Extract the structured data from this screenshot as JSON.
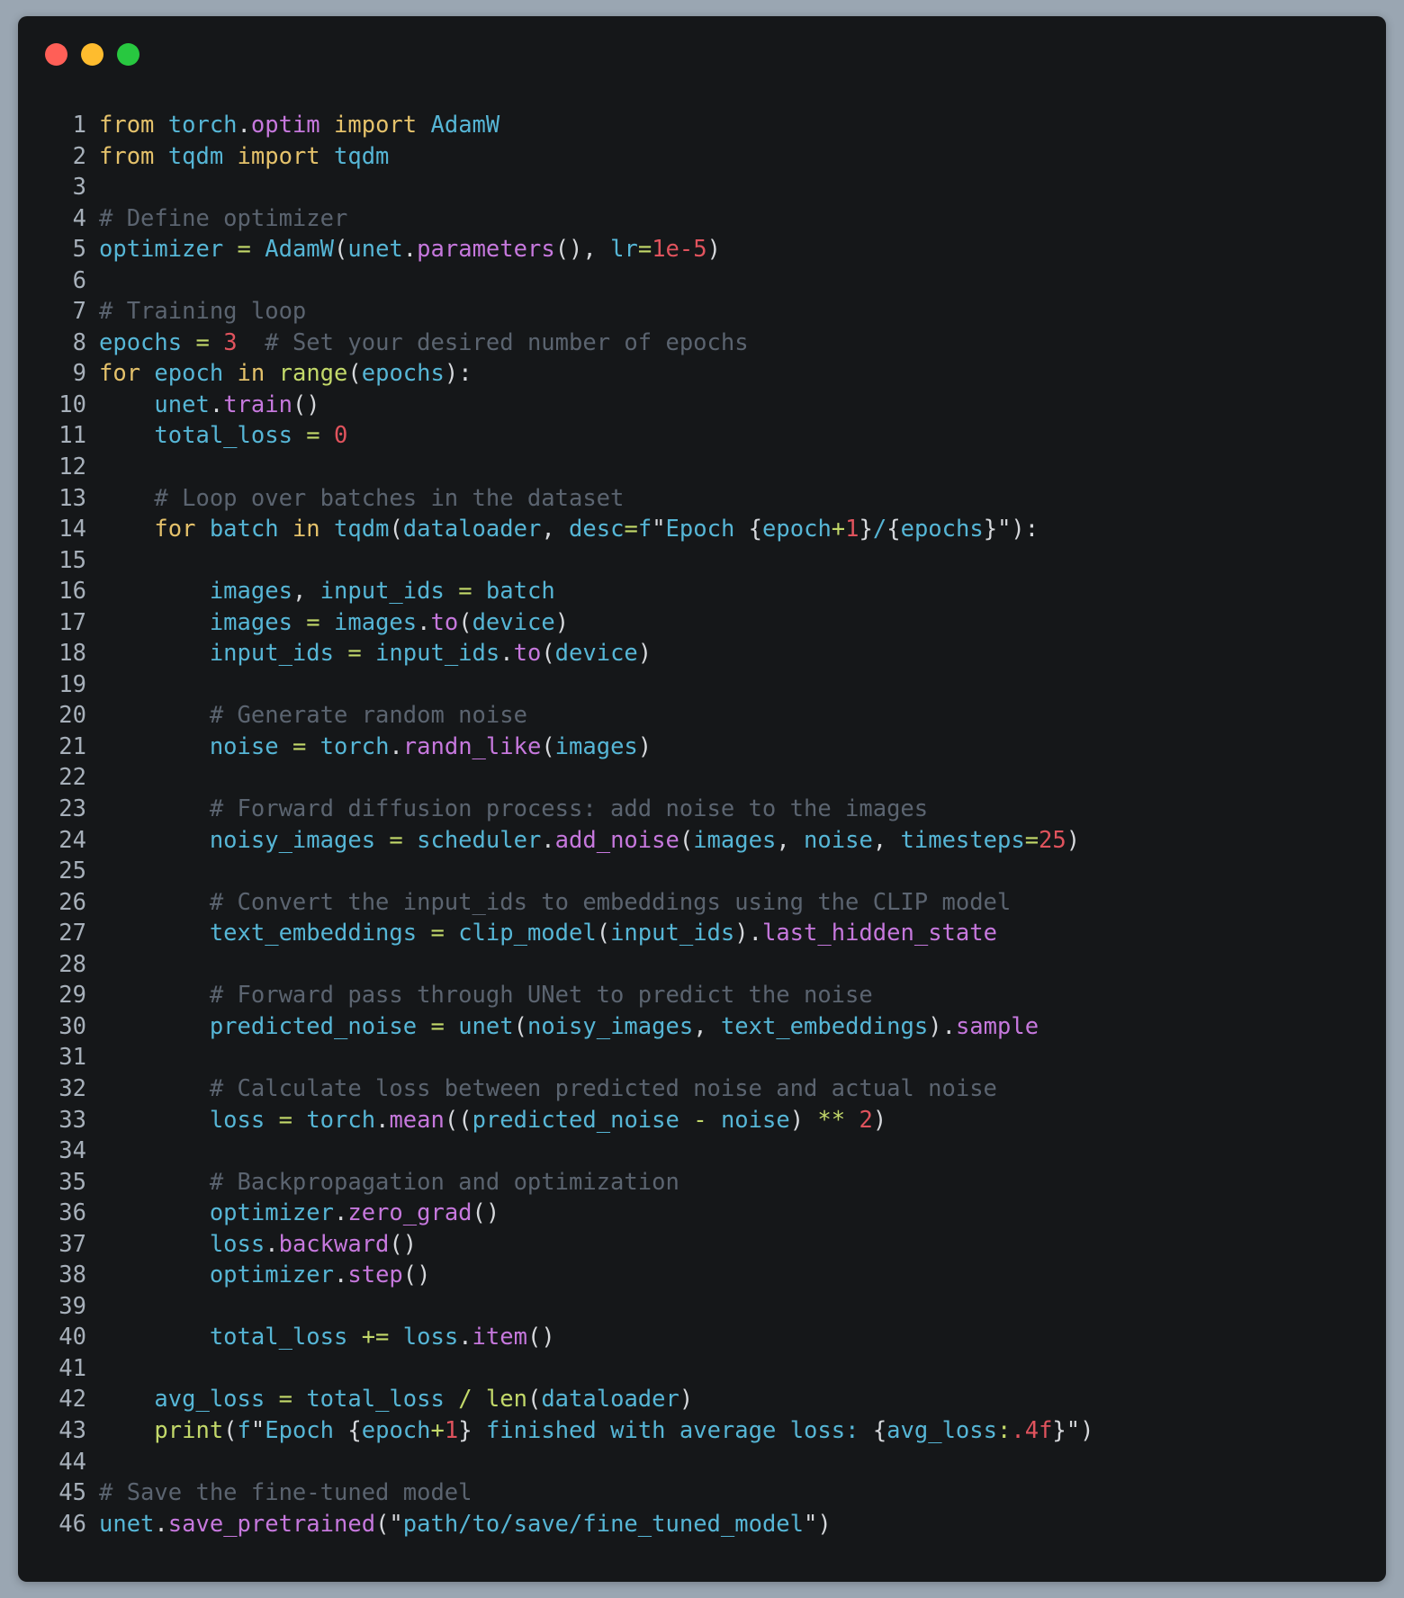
{
  "window": {
    "controls": [
      {
        "name": "close",
        "color": "#ff5f57"
      },
      {
        "name": "minimize",
        "color": "#febc2e"
      },
      {
        "name": "maximize",
        "color": "#28c840"
      }
    ]
  },
  "theme": {
    "kw": "#e5c26b",
    "var": "#56b6d6",
    "fn": "#c678dd",
    "num": "#e0535d",
    "op": "#c3d96a",
    "cm": "#5b6470",
    "p": "#d6d8dc",
    "lineno": "#a7b0ba"
  },
  "code_lines": [
    [
      [
        "kw",
        "from "
      ],
      [
        "var",
        "torch"
      ],
      [
        "p",
        "."
      ],
      [
        "fn",
        "optim "
      ],
      [
        "kw",
        "import "
      ],
      [
        "var",
        "AdamW"
      ]
    ],
    [
      [
        "kw",
        "from "
      ],
      [
        "var",
        "tqdm "
      ],
      [
        "kw",
        "import "
      ],
      [
        "var",
        "tqdm"
      ]
    ],
    [],
    [
      [
        "cm",
        "# Define optimizer"
      ]
    ],
    [
      [
        "var",
        "optimizer "
      ],
      [
        "op",
        "= "
      ],
      [
        "var",
        "AdamW"
      ],
      [
        "p",
        "("
      ],
      [
        "var",
        "unet"
      ],
      [
        "p",
        "."
      ],
      [
        "fn",
        "parameters"
      ],
      [
        "p",
        "(), "
      ],
      [
        "var",
        "lr"
      ],
      [
        "op",
        "="
      ],
      [
        "num",
        "1e-5"
      ],
      [
        "p",
        ")"
      ]
    ],
    [],
    [
      [
        "cm",
        "# Training loop"
      ]
    ],
    [
      [
        "var",
        "epochs "
      ],
      [
        "op",
        "= "
      ],
      [
        "num",
        "3"
      ],
      [
        "cm",
        "  # Set your desired number of epochs"
      ]
    ],
    [
      [
        "kw",
        "for "
      ],
      [
        "var",
        "epoch "
      ],
      [
        "kw",
        "in "
      ],
      [
        "op",
        "range"
      ],
      [
        "p",
        "("
      ],
      [
        "var",
        "epochs"
      ],
      [
        "p",
        "):"
      ]
    ],
    [
      [
        "var",
        "    unet"
      ],
      [
        "p",
        "."
      ],
      [
        "fn",
        "train"
      ],
      [
        "p",
        "()"
      ]
    ],
    [
      [
        "var",
        "    total_loss "
      ],
      [
        "op",
        "= "
      ],
      [
        "num",
        "0"
      ]
    ],
    [],
    [
      [
        "cm",
        "    # Loop over batches in the dataset"
      ]
    ],
    [
      [
        "kw",
        "    for "
      ],
      [
        "var",
        "batch "
      ],
      [
        "kw",
        "in "
      ],
      [
        "var",
        "tqdm"
      ],
      [
        "p",
        "("
      ],
      [
        "var",
        "dataloader"
      ],
      [
        "p",
        ", "
      ],
      [
        "var",
        "desc"
      ],
      [
        "op",
        "="
      ],
      [
        "var",
        "f"
      ],
      [
        "p",
        "\""
      ],
      [
        "var",
        "Epoch "
      ],
      [
        "p",
        "{"
      ],
      [
        "var",
        "epoch"
      ],
      [
        "op",
        "+"
      ],
      [
        "num",
        "1"
      ],
      [
        "p",
        "}"
      ],
      [
        "var",
        "/"
      ],
      [
        "p",
        "{"
      ],
      [
        "var",
        "epochs"
      ],
      [
        "p",
        "}\"):"
      ]
    ],
    [],
    [
      [
        "var",
        "        images"
      ],
      [
        "p",
        ", "
      ],
      [
        "var",
        "input_ids "
      ],
      [
        "op",
        "= "
      ],
      [
        "var",
        "batch"
      ]
    ],
    [
      [
        "var",
        "        images "
      ],
      [
        "op",
        "= "
      ],
      [
        "var",
        "images"
      ],
      [
        "p",
        "."
      ],
      [
        "fn",
        "to"
      ],
      [
        "p",
        "("
      ],
      [
        "var",
        "device"
      ],
      [
        "p",
        ")"
      ]
    ],
    [
      [
        "var",
        "        input_ids "
      ],
      [
        "op",
        "= "
      ],
      [
        "var",
        "input_ids"
      ],
      [
        "p",
        "."
      ],
      [
        "fn",
        "to"
      ],
      [
        "p",
        "("
      ],
      [
        "var",
        "device"
      ],
      [
        "p",
        ")"
      ]
    ],
    [],
    [
      [
        "cm",
        "        # Generate random noise"
      ]
    ],
    [
      [
        "var",
        "        noise "
      ],
      [
        "op",
        "= "
      ],
      [
        "var",
        "torch"
      ],
      [
        "p",
        "."
      ],
      [
        "fn",
        "randn_like"
      ],
      [
        "p",
        "("
      ],
      [
        "var",
        "images"
      ],
      [
        "p",
        ")"
      ]
    ],
    [],
    [
      [
        "cm",
        "        # Forward diffusion process: add noise to the images"
      ]
    ],
    [
      [
        "var",
        "        noisy_images "
      ],
      [
        "op",
        "= "
      ],
      [
        "var",
        "scheduler"
      ],
      [
        "p",
        "."
      ],
      [
        "fn",
        "add_noise"
      ],
      [
        "p",
        "("
      ],
      [
        "var",
        "images"
      ],
      [
        "p",
        ", "
      ],
      [
        "var",
        "noise"
      ],
      [
        "p",
        ", "
      ],
      [
        "var",
        "timesteps"
      ],
      [
        "op",
        "="
      ],
      [
        "num",
        "25"
      ],
      [
        "p",
        ")"
      ]
    ],
    [],
    [
      [
        "cm",
        "        # Convert the input_ids to embeddings using the CLIP model"
      ]
    ],
    [
      [
        "var",
        "        text_embeddings "
      ],
      [
        "op",
        "= "
      ],
      [
        "var",
        "clip_model"
      ],
      [
        "p",
        "("
      ],
      [
        "var",
        "input_ids"
      ],
      [
        "p",
        ")."
      ],
      [
        "fn",
        "last_hidden_state"
      ]
    ],
    [],
    [
      [
        "cm",
        "        # Forward pass through UNet to predict the noise"
      ]
    ],
    [
      [
        "var",
        "        predicted_noise "
      ],
      [
        "op",
        "= "
      ],
      [
        "var",
        "unet"
      ],
      [
        "p",
        "("
      ],
      [
        "var",
        "noisy_images"
      ],
      [
        "p",
        ", "
      ],
      [
        "var",
        "text_embeddings"
      ],
      [
        "p",
        ")."
      ],
      [
        "fn",
        "sample"
      ]
    ],
    [],
    [
      [
        "cm",
        "        # Calculate loss between predicted noise and actual noise"
      ]
    ],
    [
      [
        "var",
        "        loss "
      ],
      [
        "op",
        "= "
      ],
      [
        "var",
        "torch"
      ],
      [
        "p",
        "."
      ],
      [
        "fn",
        "mean"
      ],
      [
        "p",
        "(("
      ],
      [
        "var",
        "predicted_noise "
      ],
      [
        "op",
        "- "
      ],
      [
        "var",
        "noise"
      ],
      [
        "p",
        ") "
      ],
      [
        "op",
        "** "
      ],
      [
        "num",
        "2"
      ],
      [
        "p",
        ")"
      ]
    ],
    [],
    [
      [
        "cm",
        "        # Backpropagation and optimization"
      ]
    ],
    [
      [
        "var",
        "        optimizer"
      ],
      [
        "p",
        "."
      ],
      [
        "fn",
        "zero_grad"
      ],
      [
        "p",
        "()"
      ]
    ],
    [
      [
        "var",
        "        loss"
      ],
      [
        "p",
        "."
      ],
      [
        "fn",
        "backward"
      ],
      [
        "p",
        "()"
      ]
    ],
    [
      [
        "var",
        "        optimizer"
      ],
      [
        "p",
        "."
      ],
      [
        "fn",
        "step"
      ],
      [
        "p",
        "()"
      ]
    ],
    [],
    [
      [
        "var",
        "        total_loss "
      ],
      [
        "op",
        "+= "
      ],
      [
        "var",
        "loss"
      ],
      [
        "p",
        "."
      ],
      [
        "fn",
        "item"
      ],
      [
        "p",
        "()"
      ]
    ],
    [],
    [
      [
        "var",
        "    avg_loss "
      ],
      [
        "op",
        "= "
      ],
      [
        "var",
        "total_loss "
      ],
      [
        "op",
        "/ len"
      ],
      [
        "p",
        "("
      ],
      [
        "var",
        "dataloader"
      ],
      [
        "p",
        ")"
      ]
    ],
    [
      [
        "op",
        "    print"
      ],
      [
        "p",
        "("
      ],
      [
        "var",
        "f"
      ],
      [
        "p",
        "\""
      ],
      [
        "var",
        "Epoch "
      ],
      [
        "p",
        "{"
      ],
      [
        "var",
        "epoch"
      ],
      [
        "op",
        "+"
      ],
      [
        "num",
        "1"
      ],
      [
        "p",
        "} "
      ],
      [
        "var",
        "finished with average loss: "
      ],
      [
        "p",
        "{"
      ],
      [
        "var",
        "avg_loss"
      ],
      [
        "op",
        ":"
      ],
      [
        "num",
        ".4f"
      ],
      [
        "p",
        "}\")"
      ]
    ],
    [],
    [
      [
        "cm",
        "# Save the fine-tuned model"
      ]
    ],
    [
      [
        "var",
        "unet"
      ],
      [
        "p",
        "."
      ],
      [
        "fn",
        "save_pretrained"
      ],
      [
        "p",
        "(\""
      ],
      [
        "var",
        "path/to/save/fine_tuned_model"
      ],
      [
        "p",
        "\")"
      ]
    ]
  ]
}
